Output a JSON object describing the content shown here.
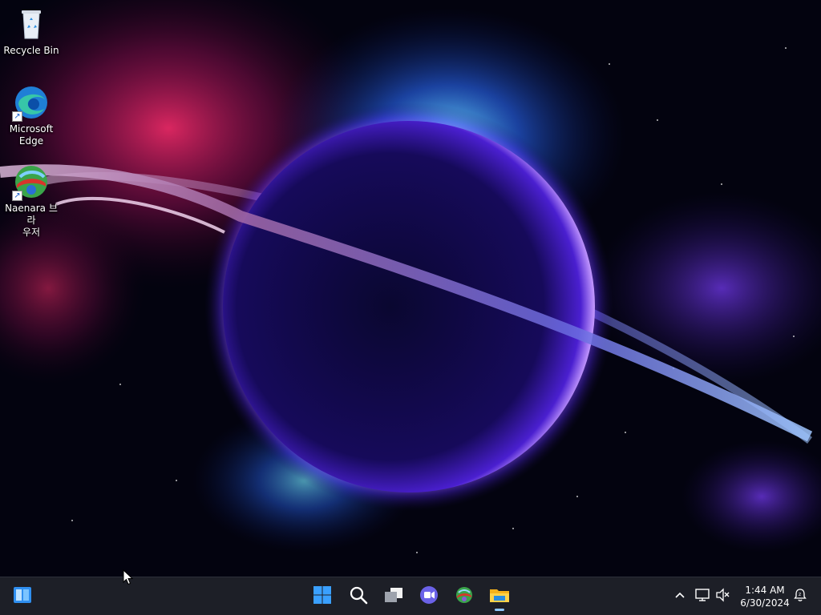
{
  "desktop": {
    "icons": [
      {
        "label": "Recycle Bin",
        "icon": "recycle-bin-icon"
      },
      {
        "label": "Microsoft\nEdge",
        "icon": "edge-icon",
        "shortcut": true
      },
      {
        "label": "Naenara 브라\n우저",
        "icon": "naenara-browser-icon",
        "shortcut": true
      }
    ]
  },
  "taskbar": {
    "widgets_icon": "widgets-icon",
    "apps": [
      {
        "name": "Start",
        "icon": "windows-start-icon"
      },
      {
        "name": "Search",
        "icon": "search-icon"
      },
      {
        "name": "Task View",
        "icon": "task-view-icon"
      },
      {
        "name": "Meet Now",
        "icon": "meet-video-icon"
      },
      {
        "name": "Naenara Browser",
        "icon": "naenara-browser-icon"
      },
      {
        "name": "File Explorer",
        "icon": "file-explorer-icon"
      }
    ],
    "tray": {
      "time": "1:44 AM",
      "date": "6/30/2024",
      "icons": [
        "chevron-up-icon",
        "network-icon",
        "volume-muted-icon",
        "notification-icon"
      ]
    }
  },
  "colors": {
    "taskbar_bg": "#1d1f27",
    "accent": "#3aa0ff",
    "planet_glow": "#8a3bff"
  }
}
